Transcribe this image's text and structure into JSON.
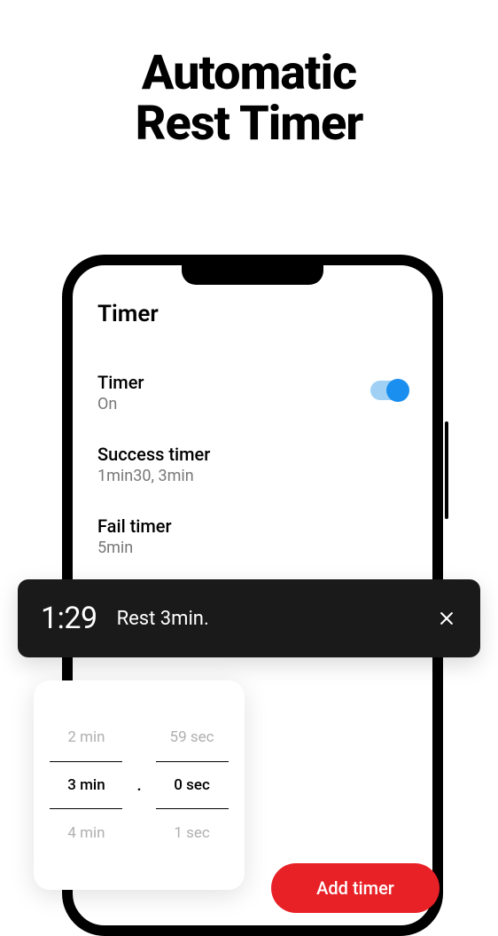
{
  "page": {
    "title_line1": "Automatic",
    "title_line2": "Rest Timer"
  },
  "phone": {
    "screen_title": "Timer",
    "settings": {
      "timer": {
        "label": "Timer",
        "value": "On",
        "toggle_on": true
      },
      "success": {
        "label": "Success timer",
        "value": "1min30, 3min"
      },
      "fail": {
        "label": "Fail timer",
        "value": "5min"
      }
    }
  },
  "toast": {
    "time": "1:29",
    "message": "Rest 3min.",
    "close_icon": "close-icon"
  },
  "picker": {
    "minutes": {
      "prev": "2 min",
      "selected": "3 min",
      "next": "4 min"
    },
    "seconds": {
      "prev": "59 sec",
      "selected": "0 sec",
      "next": "1 sec"
    },
    "separator": "."
  },
  "add_button": {
    "label": "Add timer"
  },
  "colors": {
    "accent_red": "#e82127",
    "toggle_blue": "#1a8ff0",
    "toast_bg": "#1a1a1a"
  }
}
